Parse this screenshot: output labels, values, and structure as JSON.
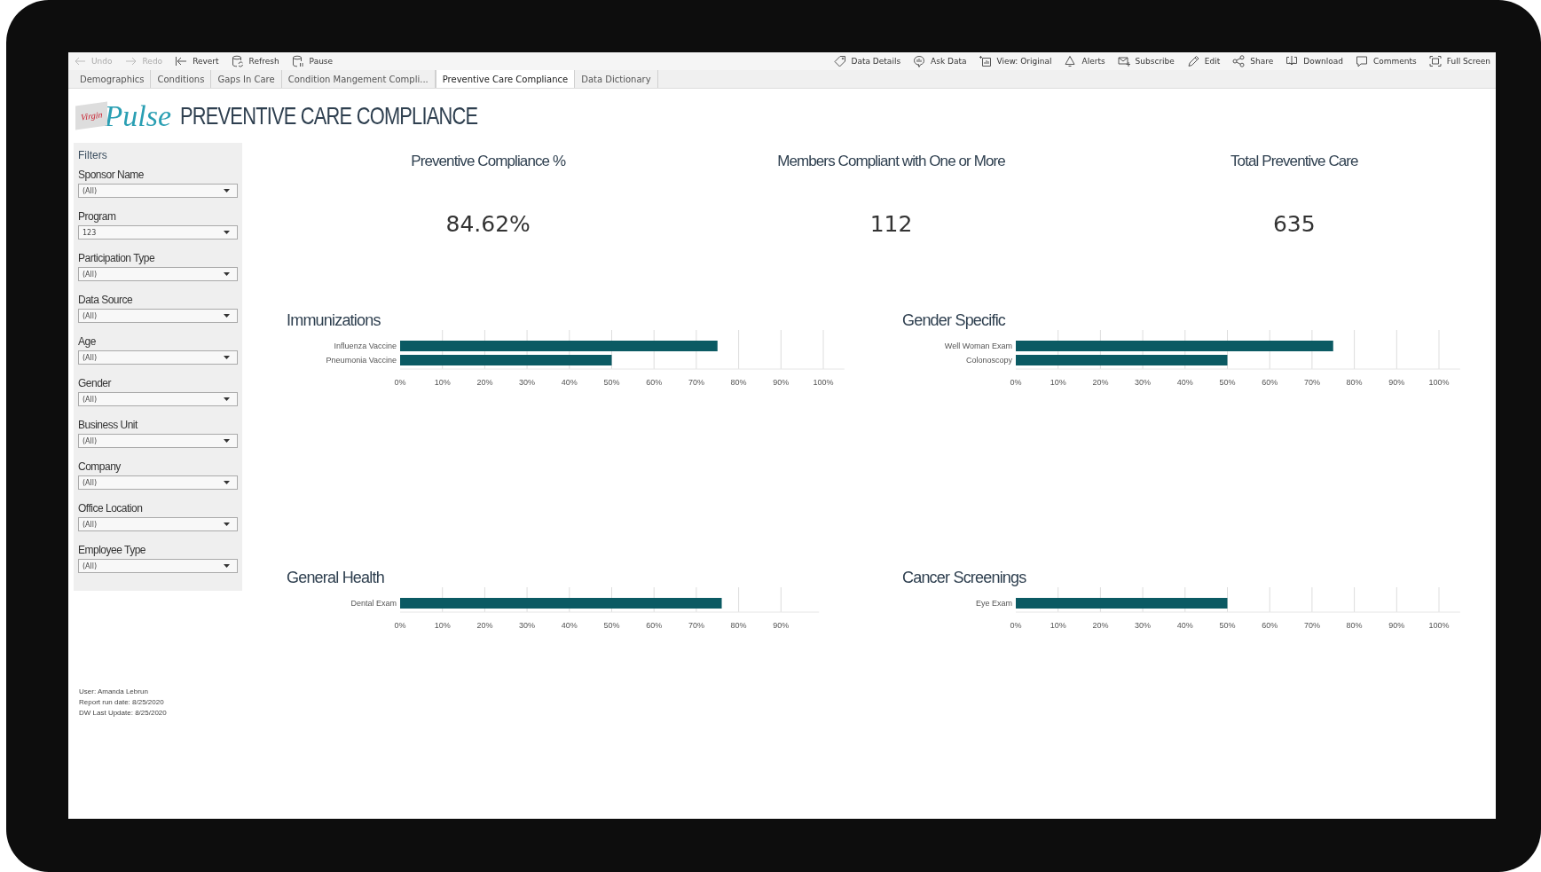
{
  "toolbar": {
    "left": [
      {
        "label": "Undo",
        "kind": "undo",
        "disabled": true
      },
      {
        "label": "Redo",
        "kind": "redo",
        "disabled": true
      },
      {
        "label": "Revert",
        "kind": "revert",
        "disabled": false
      },
      {
        "label": "Refresh",
        "kind": "refresh",
        "disabled": false
      },
      {
        "label": "Pause",
        "kind": "pause",
        "disabled": false
      }
    ],
    "right": [
      {
        "label": "Data Details",
        "kind": "details",
        "disabled": false
      },
      {
        "label": "Ask Data",
        "kind": "ask",
        "disabled": false
      },
      {
        "label": "View: Original",
        "kind": "view",
        "disabled": false
      },
      {
        "label": "Alerts",
        "kind": "alerts",
        "disabled": false
      },
      {
        "label": "Subscribe",
        "kind": "subscribe",
        "disabled": false
      },
      {
        "label": "Edit",
        "kind": "edit",
        "disabled": false
      },
      {
        "label": "Share",
        "kind": "share",
        "disabled": false
      },
      {
        "label": "Download",
        "kind": "download",
        "disabled": false
      },
      {
        "label": "Comments",
        "kind": "comments",
        "disabled": false
      },
      {
        "label": "Full Screen",
        "kind": "fullscreen",
        "disabled": false
      }
    ]
  },
  "tabs": [
    {
      "label": "Demographics",
      "selected": false
    },
    {
      "label": "Conditions",
      "selected": false
    },
    {
      "label": "Gaps In Care",
      "selected": false
    },
    {
      "label": "Condition Mangement Compli...",
      "selected": false
    },
    {
      "label": "Preventive Care Compliance",
      "selected": true
    },
    {
      "label": "Data Dictionary",
      "selected": false
    }
  ],
  "header": {
    "logo": {
      "badge": "Virgin",
      "word": "Pulse"
    },
    "title": "PREVENTIVE CARE COMPLIANCE"
  },
  "filters": {
    "title": "Filters",
    "items": [
      {
        "label": "Sponsor Name",
        "value": "(All)"
      },
      {
        "label": "Program",
        "value": "123"
      },
      {
        "label": "Participation Type",
        "value": "(All)"
      },
      {
        "label": "Data Source",
        "value": "(All)"
      },
      {
        "label": "Age",
        "value": "(All)"
      },
      {
        "label": "Gender",
        "value": "(All)"
      },
      {
        "label": "Business Unit",
        "value": "(All)"
      },
      {
        "label": "Company",
        "value": "(All)"
      },
      {
        "label": "Office Location",
        "value": "(All)"
      },
      {
        "label": "Employee Type",
        "value": "(All)"
      }
    ]
  },
  "kpis": [
    {
      "label": "Preventive Compliance %",
      "value": "84.62%"
    },
    {
      "label": "Members Compliant with One or More",
      "value": "112"
    },
    {
      "label": "Total Preventive Care",
      "value": "635"
    }
  ],
  "charts": [
    {
      "title": "Immunizations",
      "chart_data": {
        "type": "bar",
        "grid": true,
        "orientation": "horizontal",
        "categories": [
          "Influenza Vaccine",
          "Pneumonia Vaccine"
        ],
        "values": [
          75,
          50
        ],
        "xlim": [
          0,
          105
        ],
        "xticks": [
          {
            "value": 0,
            "label": "0%"
          },
          {
            "value": 10,
            "label": "10%"
          },
          {
            "value": 20,
            "label": "20%"
          },
          {
            "value": 30,
            "label": "30%"
          },
          {
            "value": 40,
            "label": "40%"
          },
          {
            "value": 50,
            "label": "50%"
          },
          {
            "value": 60,
            "label": "60%"
          },
          {
            "value": 70,
            "label": "70%"
          },
          {
            "value": 80,
            "label": "80%"
          },
          {
            "value": 90,
            "label": "90%"
          },
          {
            "value": 100,
            "label": "100%"
          }
        ]
      }
    },
    {
      "title": "Gender Specific",
      "chart_data": {
        "type": "bar",
        "grid": true,
        "orientation": "horizontal",
        "categories": [
          "Well Woman Exam",
          "Colonoscopy"
        ],
        "values": [
          75,
          50
        ],
        "xlim": [
          0,
          105
        ],
        "xticks": [
          {
            "value": 0,
            "label": "0%"
          },
          {
            "value": 10,
            "label": "10%"
          },
          {
            "value": 20,
            "label": "20%"
          },
          {
            "value": 30,
            "label": "30%"
          },
          {
            "value": 40,
            "label": "40%"
          },
          {
            "value": 50,
            "label": "50%"
          },
          {
            "value": 60,
            "label": "60%"
          },
          {
            "value": 70,
            "label": "70%"
          },
          {
            "value": 80,
            "label": "80%"
          },
          {
            "value": 90,
            "label": "90%"
          },
          {
            "value": 100,
            "label": "100%"
          }
        ]
      }
    },
    {
      "title": "General Health",
      "chart_data": {
        "type": "bar",
        "grid": true,
        "orientation": "horizontal",
        "categories": [
          "Dental Exam"
        ],
        "values": [
          76
        ],
        "xlim": [
          0,
          99
        ],
        "xticks": [
          {
            "value": 0,
            "label": "0%"
          },
          {
            "value": 10,
            "label": "10%"
          },
          {
            "value": 20,
            "label": "20%"
          },
          {
            "value": 30,
            "label": "30%"
          },
          {
            "value": 40,
            "label": "40%"
          },
          {
            "value": 50,
            "label": "50%"
          },
          {
            "value": 60,
            "label": "60%"
          },
          {
            "value": 70,
            "label": "70%"
          },
          {
            "value": 80,
            "label": "80%"
          },
          {
            "value": 90,
            "label": "90%"
          }
        ]
      }
    },
    {
      "title": "Cancer Screenings",
      "chart_data": {
        "type": "bar",
        "grid": true,
        "orientation": "horizontal",
        "categories": [
          "Eye Exam"
        ],
        "values": [
          50
        ],
        "xlim": [
          0,
          105
        ],
        "xticks": [
          {
            "value": 0,
            "label": "0%"
          },
          {
            "value": 10,
            "label": "10%"
          },
          {
            "value": 20,
            "label": "20%"
          },
          {
            "value": 30,
            "label": "30%"
          },
          {
            "value": 40,
            "label": "40%"
          },
          {
            "value": 50,
            "label": "50%"
          },
          {
            "value": 60,
            "label": "60%"
          },
          {
            "value": 70,
            "label": "70%"
          },
          {
            "value": 80,
            "label": "80%"
          },
          {
            "value": 90,
            "label": "90%"
          },
          {
            "value": 100,
            "label": "100%"
          }
        ]
      }
    }
  ],
  "footer": [
    "User: Amanda Lebrun",
    "Report run date: 8/25/2020",
    "DW Last Update: 8/25/2020"
  ]
}
